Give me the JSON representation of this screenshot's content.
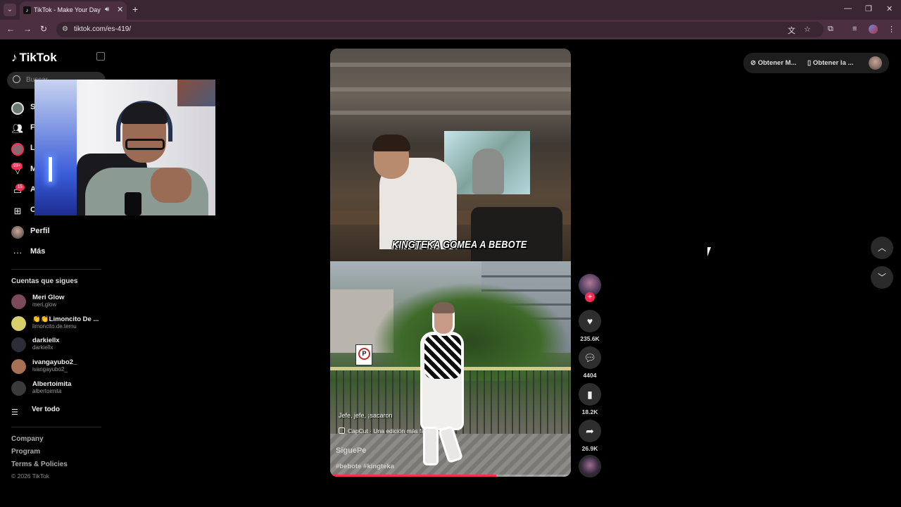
{
  "browser": {
    "tab_title": "TikTok - Make Your Day",
    "url": "tiktok.com/es-419/",
    "icons": [
      "tab-search-icon",
      "speaker-icon",
      "close-icon",
      "plus-icon",
      "back-icon",
      "forward-icon",
      "reload-icon",
      "site-info-icon",
      "translate-icon",
      "star-icon",
      "extensions-icon",
      "media-icon",
      "profile-icon",
      "menu-icon",
      "minimize-icon",
      "restore-icon",
      "window-close-icon"
    ]
  },
  "sidebar": {
    "logo": "TikTok",
    "search_placeholder": "Buscar",
    "nav": [
      {
        "label": "S",
        "icon": "avatar-icon"
      },
      {
        "label": "F",
        "icon": "friends-icon"
      },
      {
        "label": "L",
        "icon": "live-avatar-icon"
      },
      {
        "label": "M",
        "icon": "messages-icon",
        "badge": "99+"
      },
      {
        "label": "A",
        "icon": "activity-icon",
        "badge": "15"
      },
      {
        "label": "C",
        "icon": "create-icon"
      },
      {
        "label": "Perfil",
        "icon": "profile-avatar-icon"
      },
      {
        "label": "Más",
        "icon": "more-icon"
      }
    ],
    "following_title": "Cuentas que sigues",
    "following": [
      {
        "name": "Meri Glow",
        "handle": "meri.glow",
        "color": "#7a4a5a"
      },
      {
        "name": "👏👏Limoncito De ...",
        "handle": "limoncito.de.temu",
        "color": "#d9cf6a"
      },
      {
        "name": "darkiellx",
        "handle": "darkiellx",
        "color": "#2a2e36"
      },
      {
        "name": "ivangayubo2_",
        "handle": "ivangayubo2_",
        "color": "#a67055"
      },
      {
        "name": "Albertoimita",
        "handle": "albertoimita",
        "color": "#3a3a3a"
      }
    ],
    "see_all": "Ver todo",
    "footer": [
      "Company",
      "Program",
      "Terms & Policies"
    ],
    "copyright": "© 2026 TikTok"
  },
  "video": {
    "caption_overlay": "KINGTEKA GOMEA A BEBOTE",
    "lyric": "Jefe, jefe, ¡sacaron",
    "capcut": "CapCut · Una edición más fácil",
    "author": "SiguePe",
    "hashtags": "#bebote #kingteka",
    "progress": 0.69
  },
  "actions": {
    "likes": "235.6K",
    "comments": "4404",
    "saves": "18.2K",
    "shares": "26.9K"
  },
  "top_right": {
    "get_coins": "Obtener M...",
    "get_app": "Obtener la ..."
  },
  "colors": {
    "accent": "#fe2c55",
    "tab_bar": "#3a2533",
    "address_bar": "#4d2f42"
  }
}
